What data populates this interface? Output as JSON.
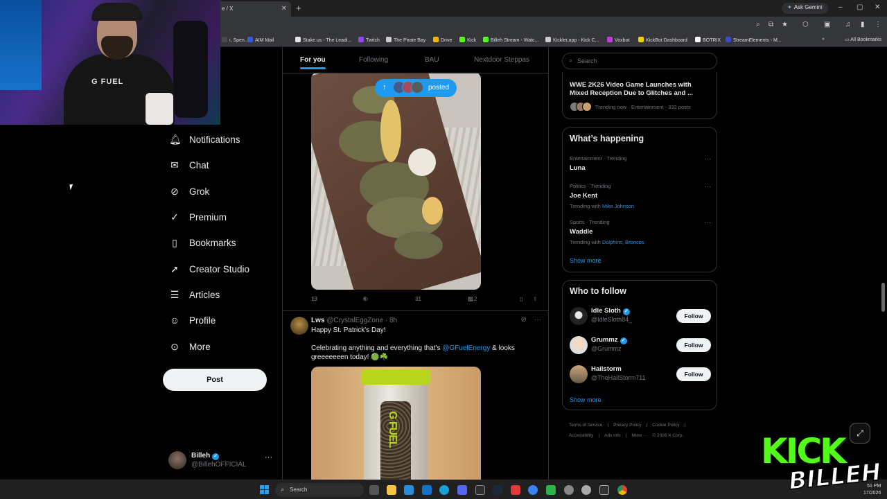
{
  "browser": {
    "tab_title": "e / X",
    "ask_gemini": "Ask Gemini",
    "bookmarks": [
      {
        "label": "i, Spen...",
        "color": "#4a4a4a"
      },
      {
        "label": "AIM Mail",
        "color": "#3a5bd9"
      },
      {
        "label": "Stake.us - The Leadi...",
        "color": "#e6e6e6"
      },
      {
        "label": "Twitch",
        "color": "#9146ff"
      },
      {
        "label": "The Pirate Bay",
        "color": "#cccccc"
      },
      {
        "label": "Drive",
        "color": "#f4b400"
      },
      {
        "label": "Kick",
        "color": "#53fc18"
      },
      {
        "label": "Billeh Stream - Watc...",
        "color": "#53fc18"
      },
      {
        "label": "Kicklet.app - Kick C...",
        "color": "#cccccc"
      },
      {
        "label": "Voxbot",
        "color": "#c23bd4"
      },
      {
        "label": "KickBot Dashboard",
        "color": "#f0d000"
      },
      {
        "label": "BOTRIX",
        "color": "#ffffff"
      },
      {
        "label": "StreamElements - M...",
        "color": "#3b4cca"
      }
    ],
    "all_bookmarks": "All Bookmarks"
  },
  "nav": {
    "items": [
      {
        "label": "Notifications",
        "icon": "bell-icon",
        "glyph": "🔔︎"
      },
      {
        "label": "Chat",
        "icon": "mail-icon",
        "glyph": "✉"
      },
      {
        "label": "Grok",
        "icon": "grok-icon",
        "glyph": "⊘"
      },
      {
        "label": "Premium",
        "icon": "premium-icon",
        "glyph": "✓"
      },
      {
        "label": "Bookmarks",
        "icon": "bookmark-icon",
        "glyph": "▯"
      },
      {
        "label": "Creator Studio",
        "icon": "rocket-icon",
        "glyph": "➚"
      },
      {
        "label": "Articles",
        "icon": "articles-icon",
        "glyph": "☰"
      },
      {
        "label": "Profile",
        "icon": "profile-icon",
        "glyph": "☺"
      },
      {
        "label": "More",
        "icon": "more-circle-icon",
        "glyph": "⊙"
      }
    ],
    "post_button": "Post",
    "account": {
      "name": "Billeh",
      "handle": "@BillehOFFICIAL"
    }
  },
  "feed": {
    "tabs": [
      "For you",
      "Following",
      "BAU",
      "Nextdoor Steppas"
    ],
    "active_tab": "For you",
    "posted_pill": "posted",
    "post1_actions": {
      "replies": "13",
      "reposts": "6",
      "likes": "31",
      "views": "812"
    },
    "post2": {
      "name": "Lws",
      "handle": "@CrystalEggZone",
      "time": "8h",
      "line1": "Happy St. Patrick's Day!",
      "line2_pre": "Celebrating anything and everything that's ",
      "line2_link": "@GFuelEnergy",
      "line2_post": " & looks greeeeeeen today! 🟢☘️"
    }
  },
  "right": {
    "search_placeholder": "Search",
    "news": {
      "title": "WWE 2K26 Video Game Launches with Mixed Reception Due to Glitches and ...",
      "meta": "Trending now · Entertainment · 332 posts"
    },
    "happening": {
      "title": "What’s happening",
      "trends": [
        {
          "category": "Entertainment · Trending",
          "name": "Luna",
          "with_label": "",
          "with_links": ""
        },
        {
          "category": "Politics · Trending",
          "name": "Joe Kent",
          "with_label": "Trending with ",
          "with_links": "Mike Johnson"
        },
        {
          "category": "Sports · Trending",
          "name": "Waddle",
          "with_label": "Trending with ",
          "with_links": "Dolphins, Broncos"
        }
      ],
      "show_more": "Show more"
    },
    "who_to_follow": {
      "title": "Who to follow",
      "accounts": [
        {
          "name": "Idle Sloth",
          "handle": "@IdleSloth84_",
          "button": "Follow"
        },
        {
          "name": "Grummz",
          "handle": "@Grummz",
          "button": "Follow"
        },
        {
          "name": "Hailstorm",
          "handle": "@TheHailStorm711",
          "button": "Follow"
        }
      ],
      "show_more": "Show more"
    },
    "footer_links": [
      "Terms of Service",
      "|",
      "Privacy Policy",
      "|",
      "Cookie Policy",
      "|",
      "Accessibility",
      "|",
      "Ads info",
      "|",
      "More ···",
      "© 2026 X Corp."
    ]
  },
  "overlay": {
    "kick": "KICK",
    "billeh": "BILLEH",
    "webcam_shirt": "G FUEL"
  },
  "taskbar": {
    "search": "Search",
    "time": "51 PM",
    "date": "17/2026"
  }
}
